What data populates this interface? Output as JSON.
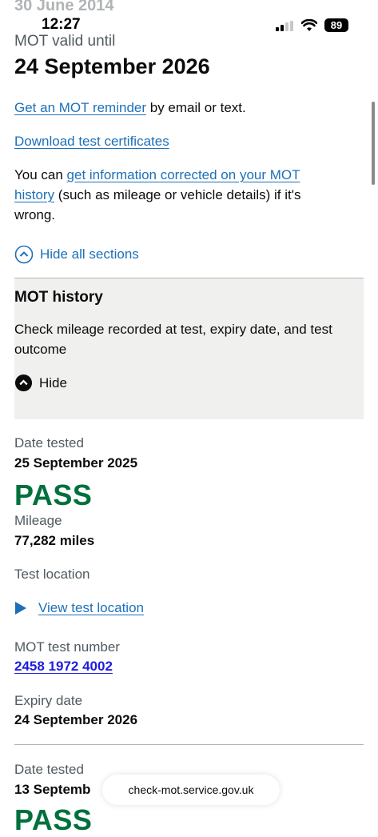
{
  "ghost_date": "30 June 2014",
  "status_bar": {
    "time": "12:27",
    "battery": "89"
  },
  "mot_valid": {
    "label": "MOT valid until",
    "date": "24 September 2026"
  },
  "reminder": {
    "link": "Get an MOT reminder",
    "suffix": " by email or text."
  },
  "download_link": "Download test certificates",
  "correction": {
    "prefix": "You can ",
    "link": "get information corrected on your MOT history",
    "suffix": " (such as mileage or vehicle details) if it's wrong."
  },
  "hide_all_label": "Hide all sections",
  "mot_history": {
    "title": "MOT history",
    "description": "Check mileage recorded at test, expiry date, and test outcome",
    "hide_label": "Hide"
  },
  "tests": [
    {
      "date_label": "Date tested",
      "date": "25 September 2025",
      "result": "PASS",
      "mileage_label": "Mileage",
      "mileage": "77,282 miles",
      "location_label": "Test location",
      "location_link": "View test location",
      "number_label": "MOT test number",
      "number": "2458 1972 4002",
      "expiry_label": "Expiry date",
      "expiry": "24 September 2026"
    },
    {
      "date_label": "Date tested",
      "date": "13 Septemb",
      "result": "PASS"
    }
  ],
  "url_bar": {
    "url": "check-mot.service.gov.uk"
  },
  "colors": {
    "link": "#1d70b8",
    "pass": "#00703c",
    "panel": "#f0f0ef",
    "text": "#0b0c0c"
  }
}
